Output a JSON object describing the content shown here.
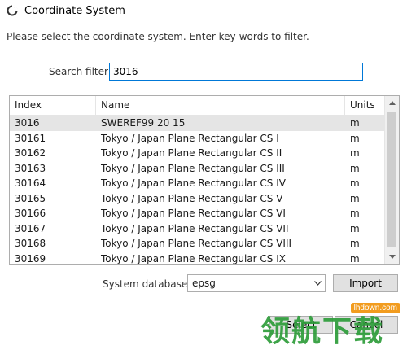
{
  "window": {
    "title": "Coordinate System",
    "icon": "qgis-icon"
  },
  "instructions": "Please select the coordinate system. Enter key-words to filter.",
  "search": {
    "label": "Search filter",
    "value": "3016"
  },
  "table": {
    "columns": [
      "Index",
      "Name",
      "Units"
    ],
    "rows": [
      {
        "index": "3016",
        "name": "SWEREF99 20 15",
        "units": "m"
      },
      {
        "index": "30161",
        "name": "Tokyo / Japan Plane Rectangular CS I",
        "units": "m"
      },
      {
        "index": "30162",
        "name": "Tokyo / Japan Plane Rectangular CS II",
        "units": "m"
      },
      {
        "index": "30163",
        "name": "Tokyo / Japan Plane Rectangular CS III",
        "units": "m"
      },
      {
        "index": "30164",
        "name": "Tokyo / Japan Plane Rectangular CS IV",
        "units": "m"
      },
      {
        "index": "30165",
        "name": "Tokyo / Japan Plane Rectangular CS V",
        "units": "m"
      },
      {
        "index": "30166",
        "name": "Tokyo / Japan Plane Rectangular CS VI",
        "units": "m"
      },
      {
        "index": "30167",
        "name": "Tokyo / Japan Plane Rectangular CS VII",
        "units": "m"
      },
      {
        "index": "30168",
        "name": "Tokyo / Japan Plane Rectangular CS VIII",
        "units": "m"
      },
      {
        "index": "30169",
        "name": "Tokyo / Japan Plane Rectangular CS IX",
        "units": "m"
      }
    ],
    "selected_index": 0
  },
  "database": {
    "label": "System database",
    "value": "epsg"
  },
  "buttons": {
    "import": "Import",
    "select": "Select",
    "cancel": "Cancel"
  },
  "watermark": {
    "text": "领航下载",
    "site": "lhdown.com"
  },
  "colors": {
    "accent": "#0078d7",
    "watermark_green": "#2e9d3a",
    "watermark_orange": "#f29c1f"
  }
}
